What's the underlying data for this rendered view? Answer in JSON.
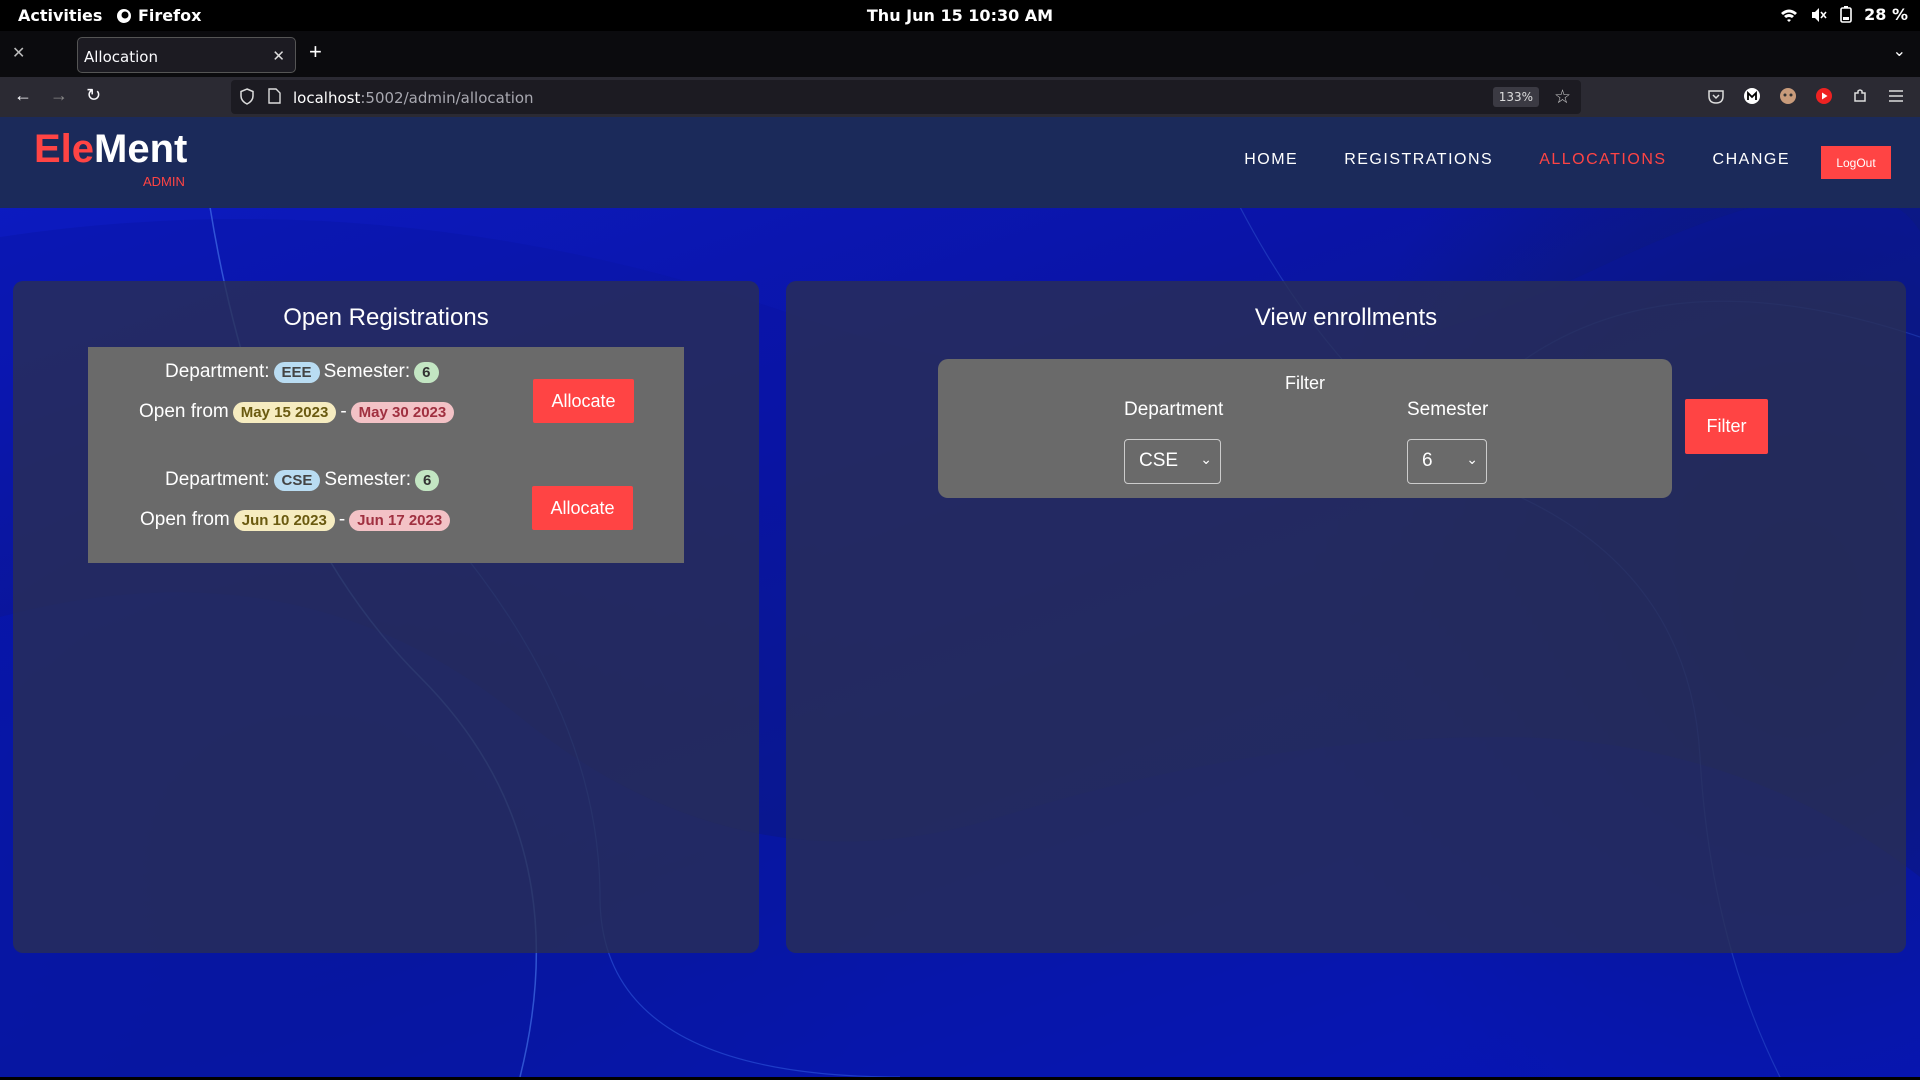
{
  "os_topbar": {
    "activities": "Activities",
    "app_name": "Firefox",
    "clock": "Thu Jun 15  10:30 AM",
    "battery": "28 %"
  },
  "browser": {
    "tab_title": "Allocation",
    "url_host": "localhost",
    "url_path": ":5002/admin/allocation",
    "zoom": "133%"
  },
  "site": {
    "logo_part1": "Ele",
    "logo_part2": "Ment",
    "logo_sub": "ADMIN",
    "nav": [
      "HOME",
      "REGISTRATIONS",
      "ALLOCATIONS",
      "CHANGE"
    ],
    "active_nav": "ALLOCATIONS",
    "logout": "LogOut",
    "accent_color": "#ff4444"
  },
  "open_registrations": {
    "title": "Open Registrations",
    "department_label": "Department:",
    "semester_label": "Semester:",
    "open_from_label": "Open from",
    "dash": "-",
    "items": [
      {
        "department": "EEE",
        "semester": "6",
        "start": "May 15 2023",
        "end": "May 30 2023",
        "action": "Allocate"
      },
      {
        "department": "CSE",
        "semester": "6",
        "start": "Jun 10 2023",
        "end": "Jun 17 2023",
        "action": "Allocate"
      }
    ]
  },
  "view_enrollments": {
    "title": "View enrollments",
    "filter_title": "Filter",
    "department_label": "Department",
    "semester_label": "Semester",
    "department_value": "CSE",
    "semester_value": "6",
    "filter_button": "Filter"
  }
}
